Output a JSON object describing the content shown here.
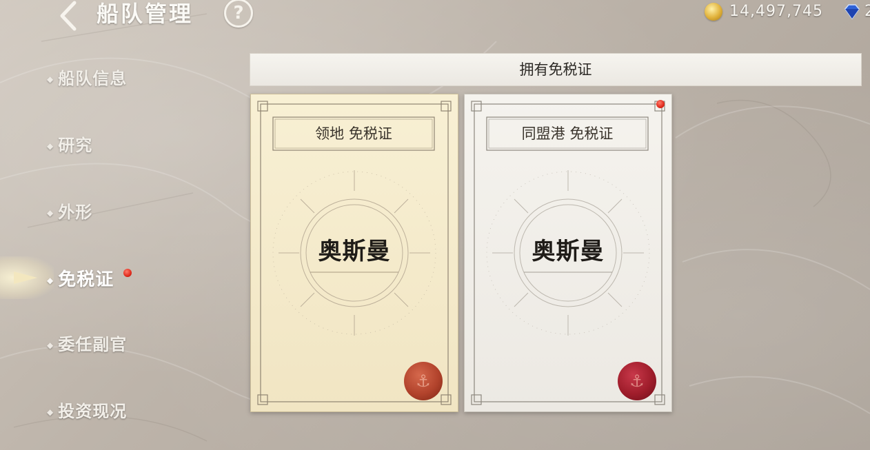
{
  "header": {
    "title": "船队管理",
    "help_label": "?",
    "gold": "14,497,745",
    "gem": "2"
  },
  "sidebar": {
    "items": [
      {
        "label": "船队信息",
        "active": false
      },
      {
        "label": "研究",
        "active": false
      },
      {
        "label": "外形",
        "active": false
      },
      {
        "label": "免税证",
        "active": true,
        "notify": true
      },
      {
        "label": "委任副官",
        "active": false
      },
      {
        "label": "投资现况",
        "active": false
      }
    ],
    "bullet": "◆"
  },
  "section": {
    "title": "拥有免税证"
  },
  "cards": [
    {
      "title": "领地 免税证",
      "name": "奥斯曼",
      "notify": false
    },
    {
      "title": "同盟港 免税证",
      "name": "奥斯曼",
      "notify": true
    }
  ],
  "seal_glyph": "⚓",
  "colors": {
    "notify_dot": "#e02a1c",
    "card1_bg": "#f6edd0",
    "card2_bg": "#f3f1ec",
    "seal1": "#b2432c",
    "seal2": "#9f1d2b"
  },
  "icons": {
    "back": "chevron-left-icon",
    "help": "question-circle-icon",
    "gold": "gold-coin-icon",
    "gem": "blue-gem-icon"
  }
}
